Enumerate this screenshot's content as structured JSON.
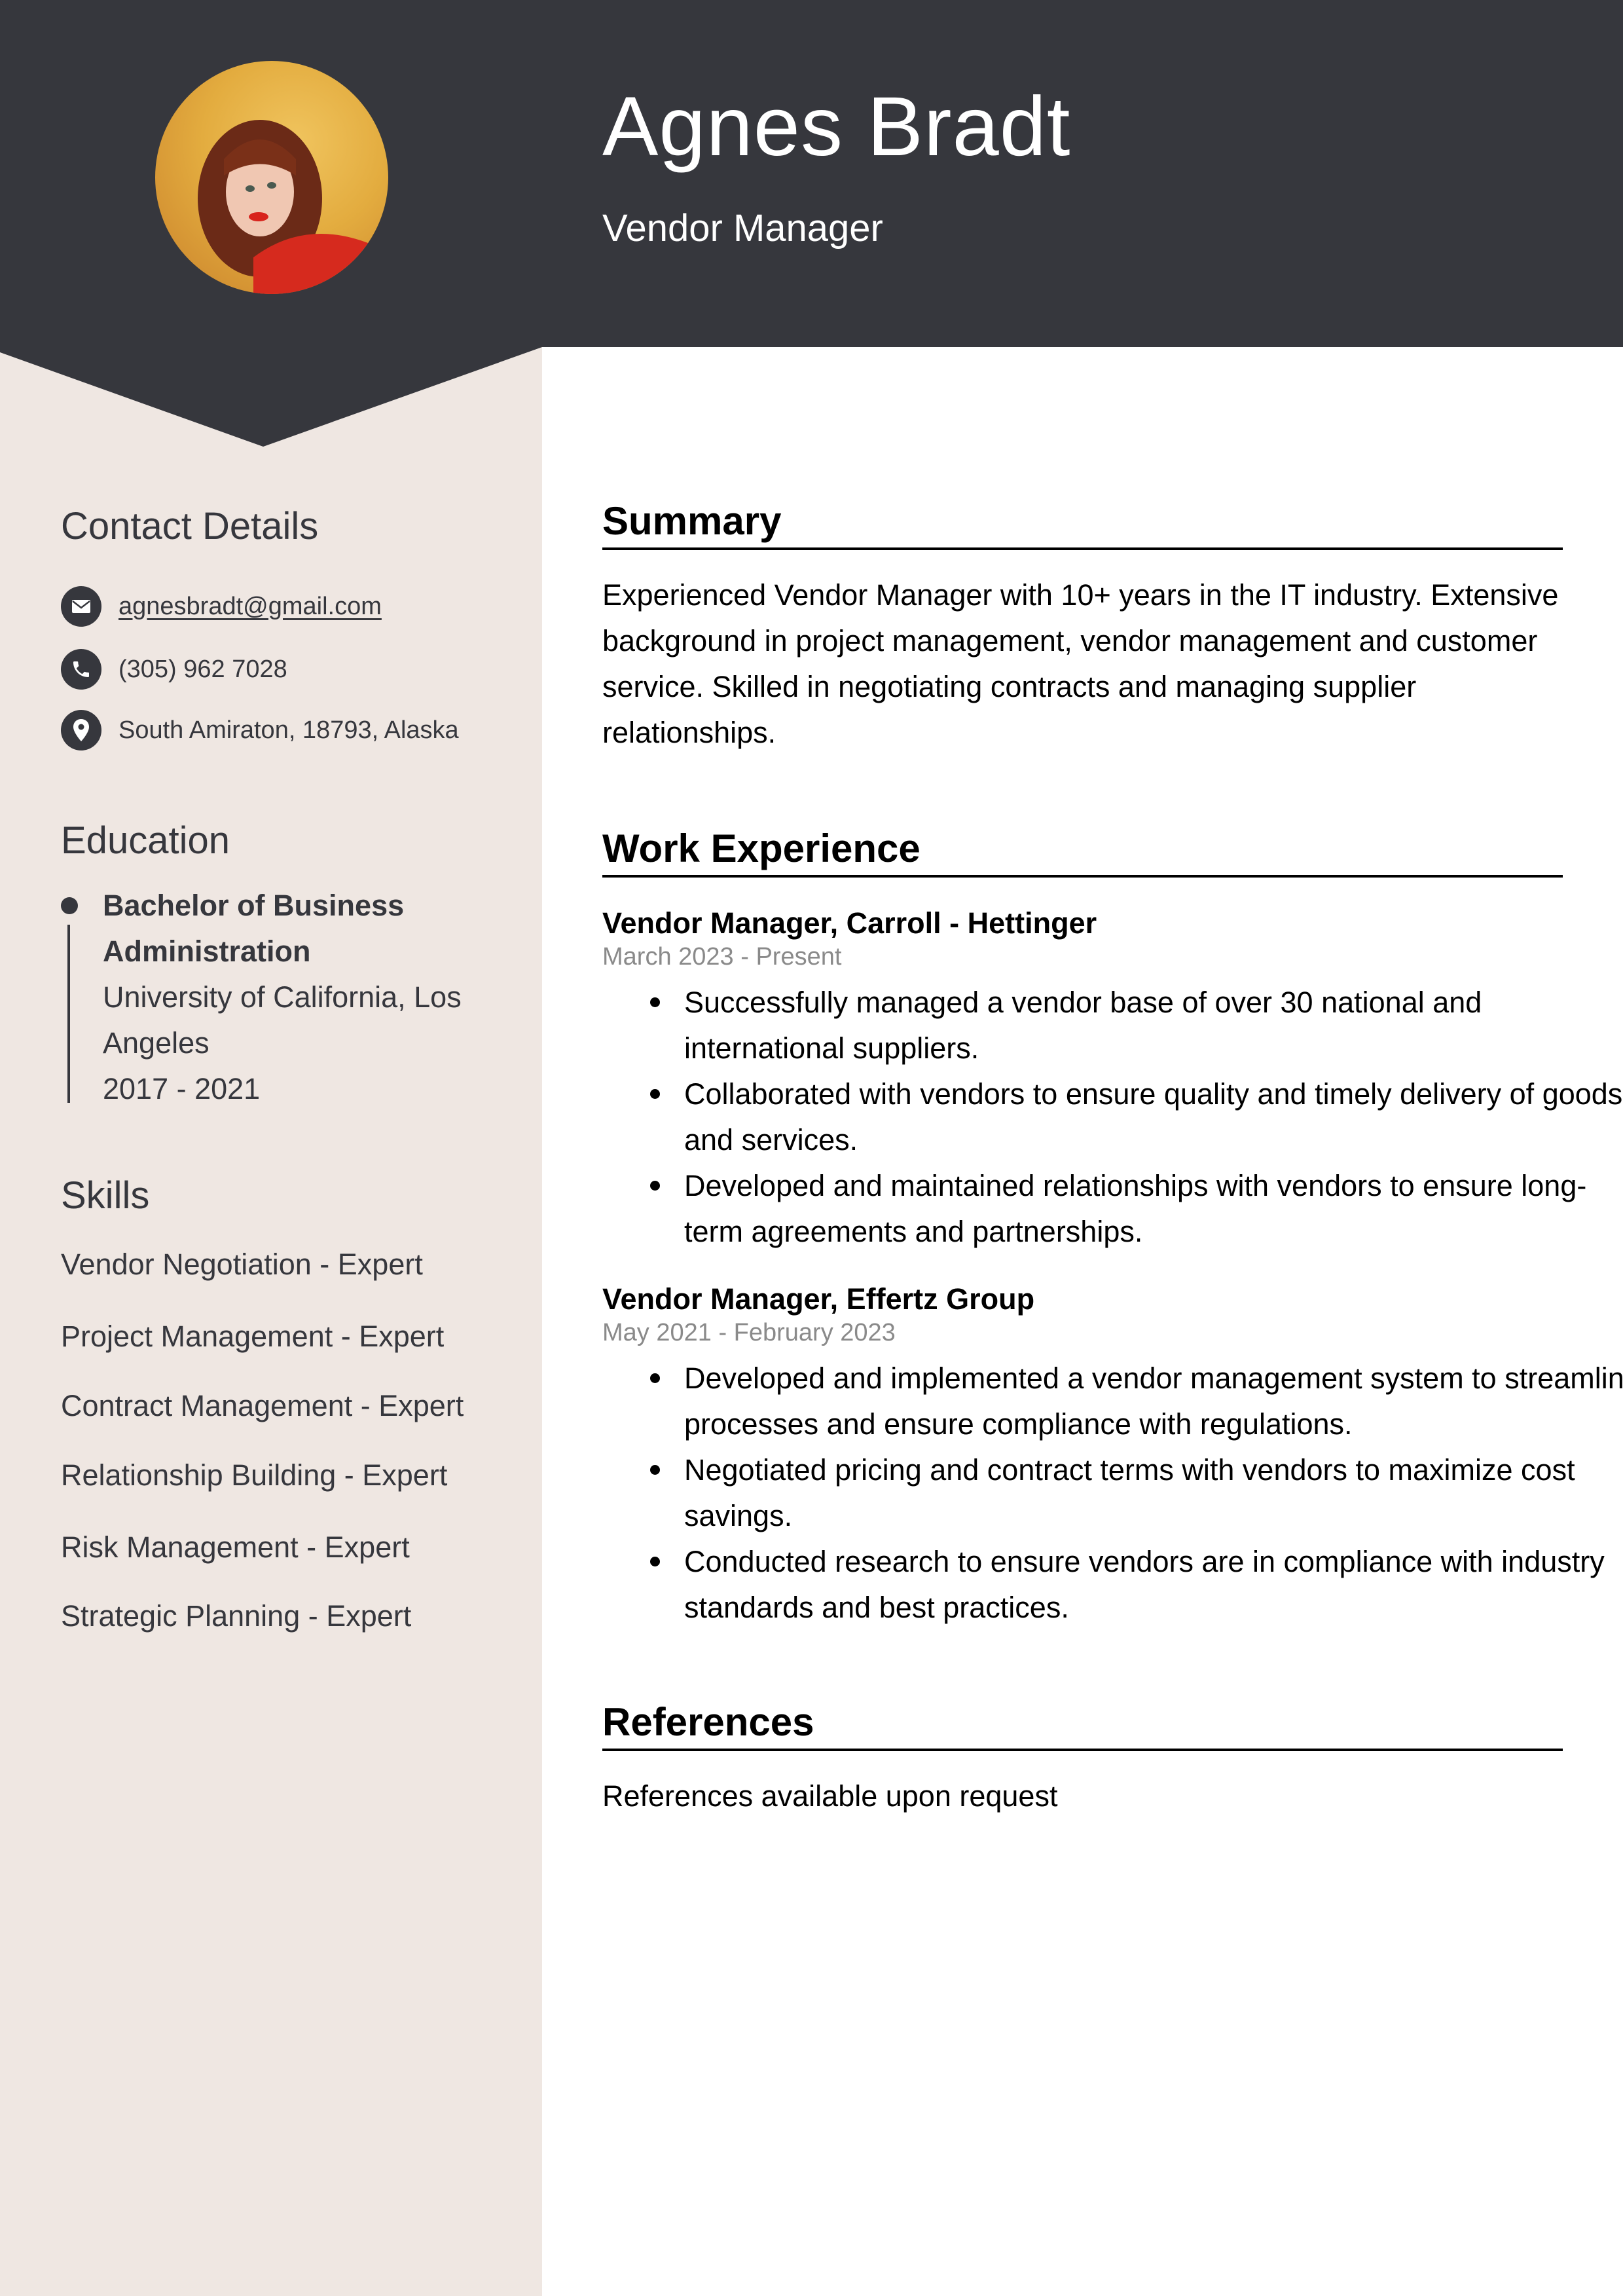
{
  "header": {
    "name": "Agnes Bradt",
    "title": "Vendor Manager",
    "colors": {
      "header_bg": "#36373d",
      "sidebar_bg": "#efe7e2",
      "text_dark": "#36373d"
    }
  },
  "sidebar": {
    "contact": {
      "heading": "Contact Details",
      "items": [
        {
          "icon": "envelope-icon",
          "text": "agnesbradt@gmail.com",
          "link": true
        },
        {
          "icon": "phone-icon",
          "text": "(305) 962 7028",
          "link": false
        },
        {
          "icon": "map-pin-icon",
          "text": "South Amiraton, 18793, Alaska",
          "link": false
        }
      ]
    },
    "education": {
      "heading": "Education",
      "items": [
        {
          "degree": "Bachelor of Business Administration",
          "school": "University of California, Los Angeles",
          "years": "2017 - 2021"
        }
      ]
    },
    "skills": {
      "heading": "Skills",
      "items": [
        "Vendor Negotiation - Expert",
        "Project Management - Expert",
        "Contract Management - Expert",
        "Relationship Building - Expert",
        "Risk Management - Expert",
        "Strategic Planning - Expert"
      ]
    }
  },
  "main": {
    "summary": {
      "heading": "Summary",
      "text": "Experienced Vendor Manager with 10+ years in the IT industry. Extensive background in project management, vendor management and customer service. Skilled in negotiating contracts and managing supplier relationships."
    },
    "work": {
      "heading": "Work Experience",
      "jobs": [
        {
          "title": "Vendor Manager, Carroll - Hettinger",
          "dates": "March 2023 - Present",
          "bullets": [
            "Successfully managed a vendor base of over 30 national and international suppliers.",
            "Collaborated with vendors to ensure quality and timely delivery of goods and services.",
            "Developed and maintained relationships with vendors to ensure long-term agreements and partnerships."
          ]
        },
        {
          "title": "Vendor Manager, Effertz Group",
          "dates": "May 2021 - February 2023",
          "bullets": [
            "Developed and implemented a vendor management system to streamline processes and ensure compliance with regulations.",
            "Negotiated pricing and contract terms with vendors to maximize cost savings.",
            "Conducted research to ensure vendors are in compliance with industry standards and best practices."
          ]
        }
      ]
    },
    "references": {
      "heading": "References",
      "text": "References available upon request"
    }
  }
}
